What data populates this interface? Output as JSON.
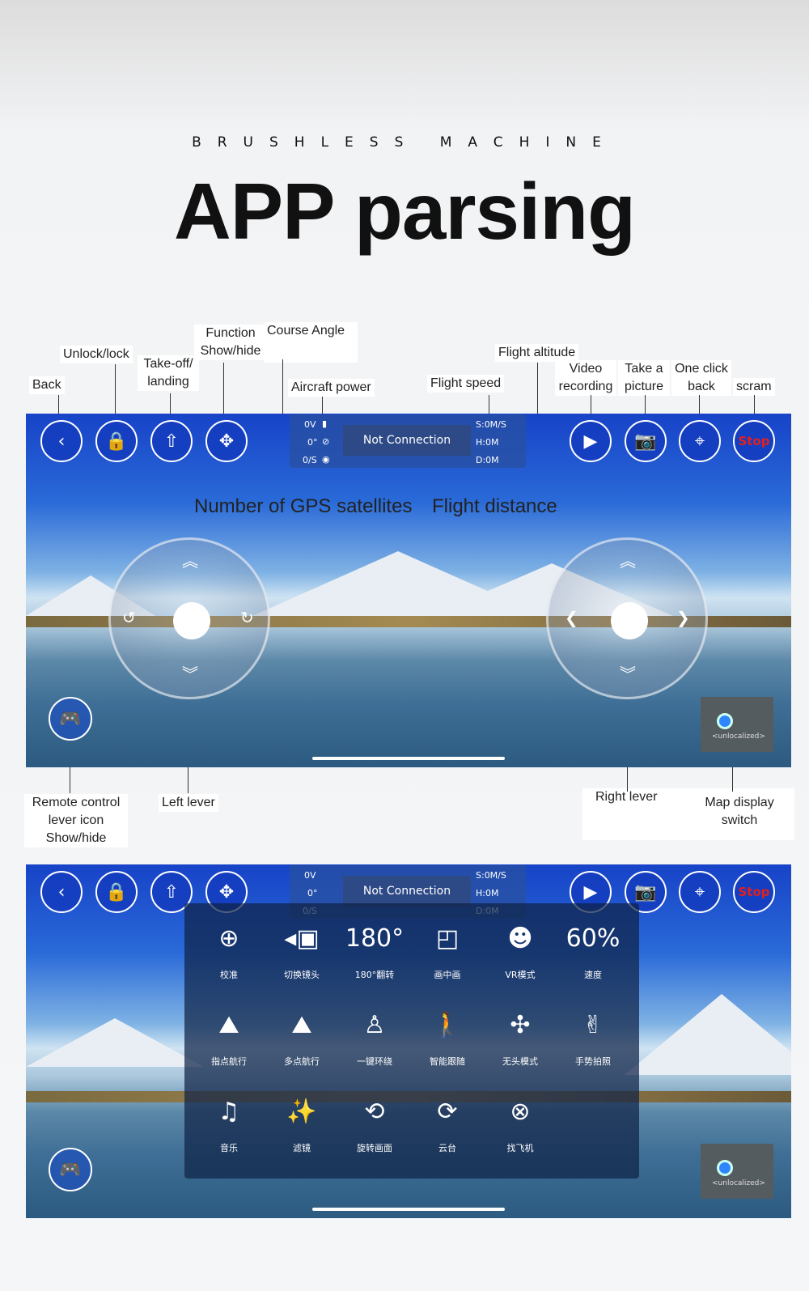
{
  "header": {
    "subtitle": "BRUSHLESS MACHINE",
    "title": "APP parsing"
  },
  "labels": {
    "back": "Back",
    "unlock": "Unlock/lock",
    "takeoff": "Take-off/ landing",
    "function": "Function Show/hide",
    "course": "Course Angle",
    "power": "Aircraft power",
    "speed": "Flight speed",
    "altitude": "Flight altitude",
    "video": "Video recording",
    "picture": "Take a picture",
    "oneclick": "One click back",
    "scram": "scram",
    "gps": "Number of GPS satellites",
    "distance": "Flight distance",
    "remote": "Remote control lever icon Show/hide",
    "left": "Left lever",
    "right": "Right lever",
    "map": "Map display switch"
  },
  "status": {
    "power": "0V",
    "angle": "0°",
    "gps": "0/S",
    "connection": "Not Connection",
    "speed": "S:0M/S",
    "height": "H:0M",
    "distance": "D:0M"
  },
  "buttons": {
    "stop": "Stop"
  },
  "minimap": {
    "text": "<unlocalized>"
  },
  "menu": [
    {
      "icon": "calibrate-icon",
      "glyph": "⊕",
      "label": "校准"
    },
    {
      "icon": "switch-camera-icon",
      "glyph": "◂▣",
      "label": "切换镜头"
    },
    {
      "icon": "flip-180-icon",
      "glyph": "180°",
      "label": "180°翻转"
    },
    {
      "icon": "picture-in-picture-icon",
      "glyph": "◰",
      "label": "画中画"
    },
    {
      "icon": "vr-mode-icon",
      "glyph": "☻",
      "label": "VR模式"
    },
    {
      "icon": "speed-icon",
      "glyph": "60%",
      "label": "速度"
    },
    {
      "icon": "waypoint-icon",
      "glyph": "⛰",
      "label": "指点航行"
    },
    {
      "icon": "multi-waypoint-icon",
      "glyph": "⛰",
      "label": "多点航行"
    },
    {
      "icon": "orbit-icon",
      "glyph": "♙",
      "label": "一键环绕"
    },
    {
      "icon": "follow-icon",
      "glyph": "🚶",
      "label": "智能跟随"
    },
    {
      "icon": "headless-icon",
      "glyph": "✣",
      "label": "无头模式"
    },
    {
      "icon": "gesture-icon",
      "glyph": "✌",
      "label": "手势拍照"
    },
    {
      "icon": "music-icon",
      "glyph": "♫",
      "label": "音乐"
    },
    {
      "icon": "filter-icon",
      "glyph": "✨",
      "label": "滤镜"
    },
    {
      "icon": "rotate-screen-icon",
      "glyph": "⟲",
      "label": "旋转画面"
    },
    {
      "icon": "gimbal-icon",
      "glyph": "⟳",
      "label": "云台"
    },
    {
      "icon": "find-drone-icon",
      "glyph": "⊗",
      "label": "找飞机"
    }
  ]
}
